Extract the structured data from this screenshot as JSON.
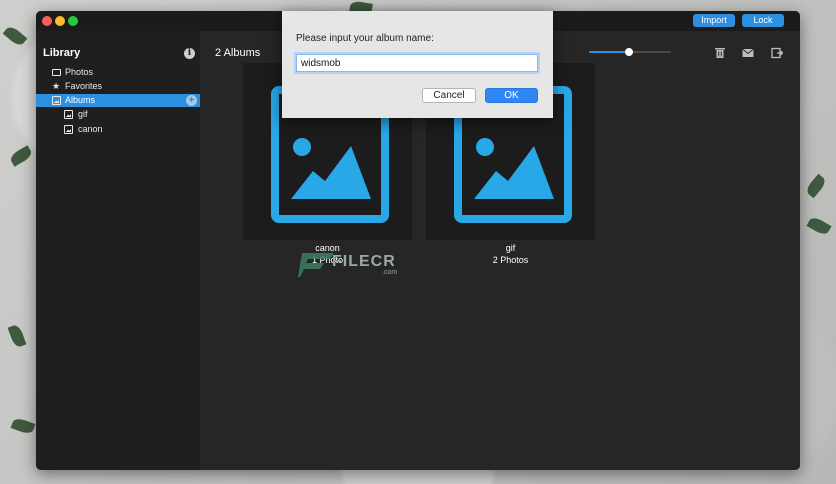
{
  "window": {
    "import_label": "Import",
    "lock_label": "Lock"
  },
  "sidebar": {
    "title": "Library",
    "items": [
      {
        "label": "Photos",
        "icon": "photo-icon"
      },
      {
        "label": "Favorites",
        "icon": "star-icon"
      },
      {
        "label": "Albums",
        "icon": "album-icon",
        "selected": true
      },
      {
        "label": "gif",
        "icon": "album-icon"
      },
      {
        "label": "canon",
        "icon": "album-icon"
      }
    ]
  },
  "main": {
    "albums_count": "2 Albums",
    "zoom_level": 0.49,
    "albums": [
      {
        "name": "canon",
        "count": "1 Photo"
      },
      {
        "name": "gif",
        "count": "2 Photos"
      }
    ]
  },
  "dialog": {
    "prompt": "Please input your album name:",
    "input_value": "widsmob",
    "cancel_label": "Cancel",
    "ok_label": "OK"
  },
  "watermark": {
    "text": "FILECR",
    "suffix": ".com"
  },
  "colors": {
    "accent": "#2d8fe0",
    "album_icon": "#29a8e8",
    "window_bg": "#262626",
    "sidebar_bg": "#1f1f1f"
  }
}
